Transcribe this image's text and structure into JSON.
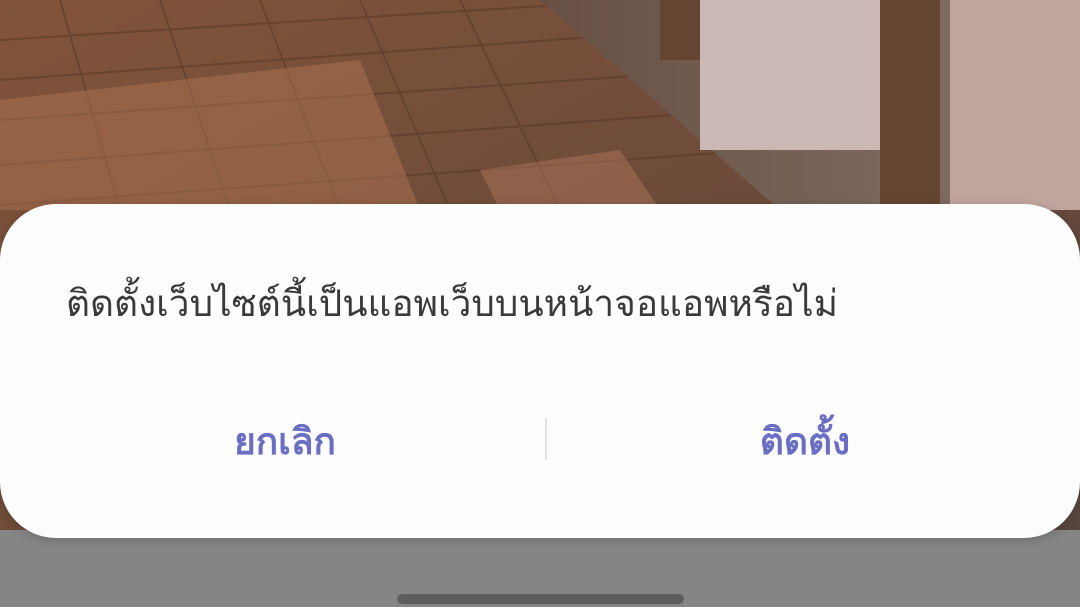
{
  "dialog": {
    "message": "ติดตั้งเว็บไซต์นี้เป็นแอพเว็บบนหน้าจอแอพหรือไม่",
    "cancel_label": "ยกเลิก",
    "install_label": "ติดตั้ง"
  },
  "colors": {
    "button_text": "#6a6fc4",
    "dialog_background": "#fdfdfd",
    "message_text": "#3a3a3a"
  }
}
